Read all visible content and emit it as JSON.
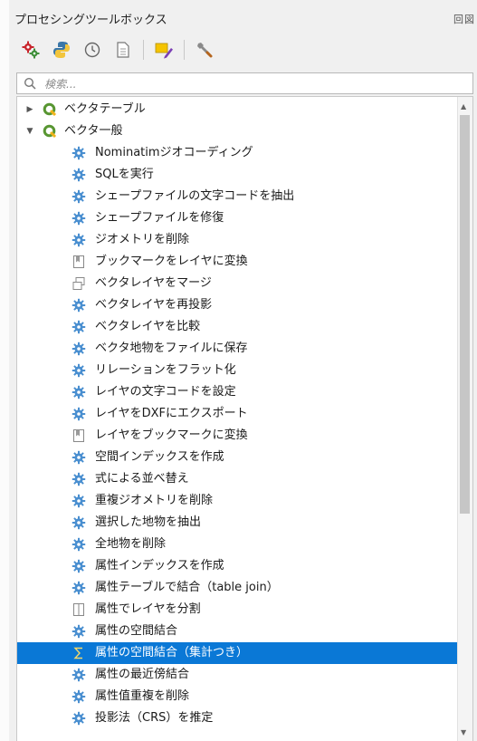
{
  "panel": {
    "title": "プロセシングツールボックス",
    "window_buttons": "回図"
  },
  "toolbar": {
    "buttons": [
      {
        "icon": "models-gear-icon"
      },
      {
        "icon": "python-scripts-icon"
      },
      {
        "icon": "history-clock-icon"
      },
      {
        "icon": "results-viewer-icon"
      },
      {
        "icon": "edit-features-in-place-icon"
      },
      {
        "icon": "options-wrench-icon"
      }
    ]
  },
  "search": {
    "placeholder": "検索..."
  },
  "tree": {
    "groups": [
      {
        "label": "ベクタテーブル",
        "expanded": false
      },
      {
        "label": "ベクタ一般",
        "expanded": true
      }
    ],
    "items": [
      {
        "label": "Nominatimジオコーディング",
        "icon": "algorithm-gear-icon"
      },
      {
        "label": "SQLを実行",
        "icon": "algorithm-gear-icon"
      },
      {
        "label": "シェープファイルの文字コードを抽出",
        "icon": "algorithm-gear-icon"
      },
      {
        "label": "シェープファイルを修復",
        "icon": "algorithm-gear-icon"
      },
      {
        "label": "ジオメトリを削除",
        "icon": "algorithm-gear-icon"
      },
      {
        "label": "ブックマークをレイヤに変換",
        "icon": "bookmark-icon"
      },
      {
        "label": "ベクタレイヤをマージ",
        "icon": "merge-layers-icon"
      },
      {
        "label": "ベクタレイヤを再投影",
        "icon": "algorithm-gear-icon"
      },
      {
        "label": "ベクタレイヤを比較",
        "icon": "algorithm-gear-icon"
      },
      {
        "label": "ベクタ地物をファイルに保存",
        "icon": "algorithm-gear-icon"
      },
      {
        "label": "リレーションをフラット化",
        "icon": "algorithm-gear-icon"
      },
      {
        "label": "レイヤの文字コードを設定",
        "icon": "algorithm-gear-icon"
      },
      {
        "label": "レイヤをDXFにエクスポート",
        "icon": "algorithm-gear-icon"
      },
      {
        "label": "レイヤをブックマークに変換",
        "icon": "bookmark-icon"
      },
      {
        "label": "空間インデックスを作成",
        "icon": "algorithm-gear-icon"
      },
      {
        "label": "式による並べ替え",
        "icon": "algorithm-gear-icon"
      },
      {
        "label": "重複ジオメトリを削除",
        "icon": "algorithm-gear-icon"
      },
      {
        "label": "選択した地物を抽出",
        "icon": "algorithm-gear-icon"
      },
      {
        "label": "全地物を削除",
        "icon": "algorithm-gear-icon"
      },
      {
        "label": "属性インデックスを作成",
        "icon": "algorithm-gear-icon"
      },
      {
        "label": "属性テーブルで結合（table join）",
        "icon": "algorithm-gear-icon"
      },
      {
        "label": "属性でレイヤを分割",
        "icon": "split-layer-icon"
      },
      {
        "label": "属性の空間結合",
        "icon": "algorithm-gear-icon"
      },
      {
        "label": "属性の空間結合（集計つき）",
        "icon": "sigma-icon",
        "selected": true
      },
      {
        "label": "属性の最近傍結合",
        "icon": "algorithm-gear-icon"
      },
      {
        "label": "属性值重複を削除",
        "icon": "algorithm-gear-icon"
      },
      {
        "label": "投影法（CRS）を推定",
        "icon": "algorithm-gear-icon"
      }
    ]
  },
  "colors": {
    "selection": "#0a78d6",
    "gear": "#4a8fd0",
    "qgis_green": "#589632"
  }
}
